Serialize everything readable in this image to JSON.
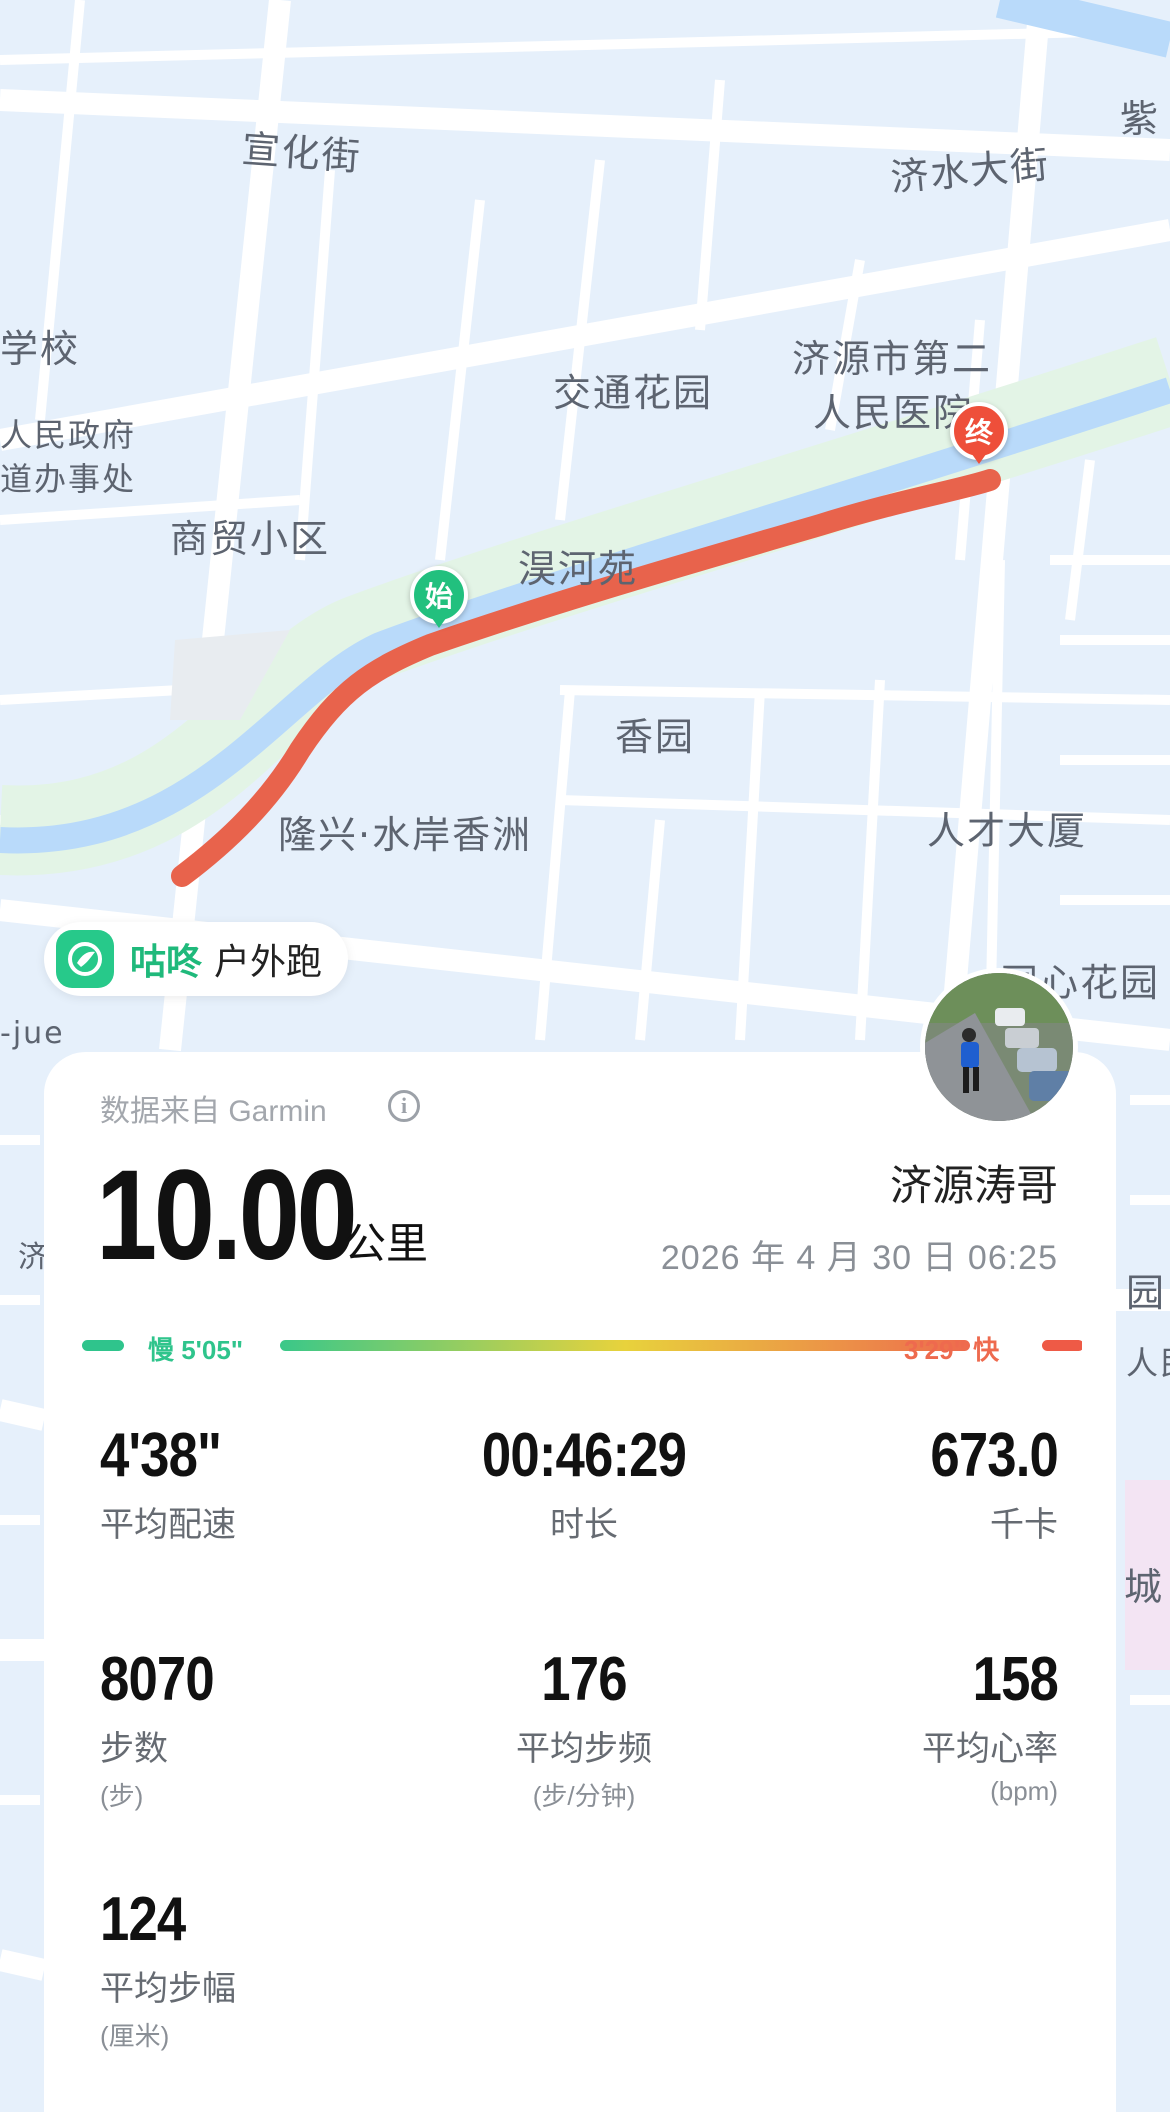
{
  "map": {
    "labels": {
      "xuanhua": "宣化街",
      "jishui": "济水大街",
      "zi": "紫",
      "xuexiao": "学校",
      "zhengfu": "人民政府",
      "banshichu": "道办事处",
      "jiaotong": "交通花园",
      "hospital1": "济源市第二",
      "hospital2": "人民医院",
      "shangmao": "商贸小区",
      "mang": "淏河苑",
      "xiangyuan": "香园",
      "longxing": "隆兴·水岸香洲",
      "rencai": "人才大厦",
      "tongxin": "同心花园",
      "jue": "-jue",
      "ji": "济",
      "yuan": "园",
      "renmin": "人民",
      "cheng": "城"
    },
    "start_marker": "始",
    "end_marker": "终",
    "route_color": "#e8634c"
  },
  "brand": {
    "name": "咕咚",
    "activity": "户外跑",
    "icon": "runner-icon"
  },
  "summary": {
    "source": "数据来自 Garmin",
    "distance": "10.00",
    "distance_unit": "公里",
    "user_name": "济源涛哥",
    "datetime": "2026 年 4 月 30 日  06:25"
  },
  "pace_legend": {
    "slow": "慢 5'05\"",
    "fast": "3'29\" 快",
    "slow_color": "#2fc48c",
    "fast_color": "#ee5a46"
  },
  "stats": [
    {
      "value": "4'38\"",
      "label": "平均配速",
      "unit": ""
    },
    {
      "value": "00:46:29",
      "label": "时长",
      "unit": ""
    },
    {
      "value": "673.0",
      "label": "千卡",
      "unit": ""
    },
    {
      "value": "8070",
      "label": "步数",
      "unit": "(步)"
    },
    {
      "value": "176",
      "label": "平均步频",
      "unit": "(步/分钟)"
    },
    {
      "value": "158",
      "label": "平均心率",
      "unit": "(bpm)"
    },
    {
      "value": "124",
      "label": "平均步幅",
      "unit": "(厘米)"
    }
  ]
}
